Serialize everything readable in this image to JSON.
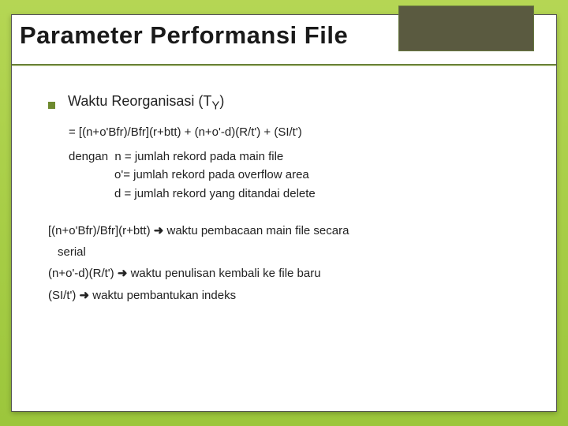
{
  "slide": {
    "title": "Parameter Performansi File",
    "heading_prefix": "Waktu Reorganisasi (T",
    "heading_sub": "Y",
    "heading_suffix": ")",
    "formula": "= [(n+o'Bfr)/Bfr](r+btt) + (n+o'-d)(R/t') + (SI/t')",
    "defs_label": "dengan",
    "def_n": "n = jumlah rekord pada main file",
    "def_o": "o'= jumlah rekord pada overflow area",
    "def_d": "d = jumlah rekord yang ditandai delete",
    "explain1_lhs": "[(n+o'Bfr)/Bfr](r+btt)",
    "explain1_rhs_a": "waktu pembacaan main file secara",
    "explain1_rhs_b": "serial",
    "explain2_lhs": "(n+o'-d)(R/t')",
    "explain2_rhs": "waktu penulisan kembali ke file baru",
    "explain3_lhs": "(SI/t')",
    "explain3_rhs": "waktu pembantukan indeks",
    "arrow": "➜"
  }
}
